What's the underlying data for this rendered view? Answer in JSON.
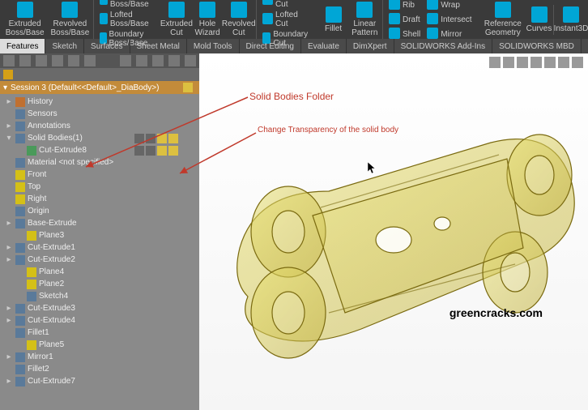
{
  "ribbon": {
    "extruded": "Extruded Boss/Base",
    "revolved": "Revolved Boss/Base",
    "swept": "Swept Boss/Base",
    "lofted": "Lofted Boss/Base",
    "boundary": "Boundary Boss/Base",
    "extrudedCut": "Extruded Cut",
    "hole": "Hole Wizard",
    "revolvedCut": "Revolved Cut",
    "sweptCut": "Swept Cut",
    "loftedCut": "Lofted Cut",
    "boundaryCut": "Boundary Cut",
    "fillet": "Fillet",
    "linear": "Linear Pattern",
    "rib": "Rib",
    "draft": "Draft",
    "shell": "Shell",
    "wrap": "Wrap",
    "intersect": "Intersect",
    "mirror": "Mirror",
    "refGeo": "Reference Geometry",
    "curves": "Curves",
    "instant": "Instant3D"
  },
  "tabs": [
    "Features",
    "Sketch",
    "Surfaces",
    "Sheet Metal",
    "Mold Tools",
    "Direct Editing",
    "Evaluate",
    "DimXpert",
    "SOLIDWORKS Add-Ins",
    "SOLIDWORKS MBD"
  ],
  "tree": {
    "selected": "Session 3 (Default<<Default>_DiaBody>)",
    "items": [
      {
        "t": "History",
        "i": 0,
        "exp": "▸",
        "c": "org"
      },
      {
        "t": "Sensors",
        "i": 0,
        "exp": "",
        "c": ""
      },
      {
        "t": "Annotations",
        "i": 0,
        "exp": "▸",
        "c": ""
      },
      {
        "t": "Solid Bodies(1)",
        "i": 0,
        "exp": "▾",
        "c": ""
      },
      {
        "t": "Cut-Extrude8",
        "i": 1,
        "exp": "",
        "c": "grn"
      },
      {
        "t": "Material <not specified>",
        "i": 0,
        "exp": "",
        "c": ""
      },
      {
        "t": "Front",
        "i": 0,
        "exp": "",
        "c": "yel"
      },
      {
        "t": "Top",
        "i": 0,
        "exp": "",
        "c": "yel"
      },
      {
        "t": "Right",
        "i": 0,
        "exp": "",
        "c": "yel"
      },
      {
        "t": "Origin",
        "i": 0,
        "exp": "",
        "c": ""
      },
      {
        "t": "Base-Extrude",
        "i": 0,
        "exp": "▸",
        "c": ""
      },
      {
        "t": "Plane3",
        "i": 1,
        "exp": "",
        "c": "yel"
      },
      {
        "t": "Cut-Extrude1",
        "i": 0,
        "exp": "▸",
        "c": ""
      },
      {
        "t": "Cut-Extrude2",
        "i": 0,
        "exp": "▸",
        "c": ""
      },
      {
        "t": "Plane4",
        "i": 1,
        "exp": "",
        "c": "yel"
      },
      {
        "t": "Plane2",
        "i": 1,
        "exp": "",
        "c": "yel"
      },
      {
        "t": "Sketch4",
        "i": 1,
        "exp": "",
        "c": ""
      },
      {
        "t": "Cut-Extrude3",
        "i": 0,
        "exp": "▸",
        "c": ""
      },
      {
        "t": "Cut-Extrude4",
        "i": 0,
        "exp": "▸",
        "c": ""
      },
      {
        "t": "Fillet1",
        "i": 0,
        "exp": "",
        "c": ""
      },
      {
        "t": "Plane5",
        "i": 1,
        "exp": "",
        "c": "yel"
      },
      {
        "t": "Mirror1",
        "i": 0,
        "exp": "▸",
        "c": ""
      },
      {
        "t": "Fillet2",
        "i": 0,
        "exp": "",
        "c": ""
      },
      {
        "t": "Cut-Extrude7",
        "i": 0,
        "exp": "▸",
        "c": ""
      }
    ]
  },
  "annotations": {
    "a1": "Solid Bodies Folder",
    "a2": "Change Transparency of the solid body"
  },
  "watermark": "greencracks.com"
}
